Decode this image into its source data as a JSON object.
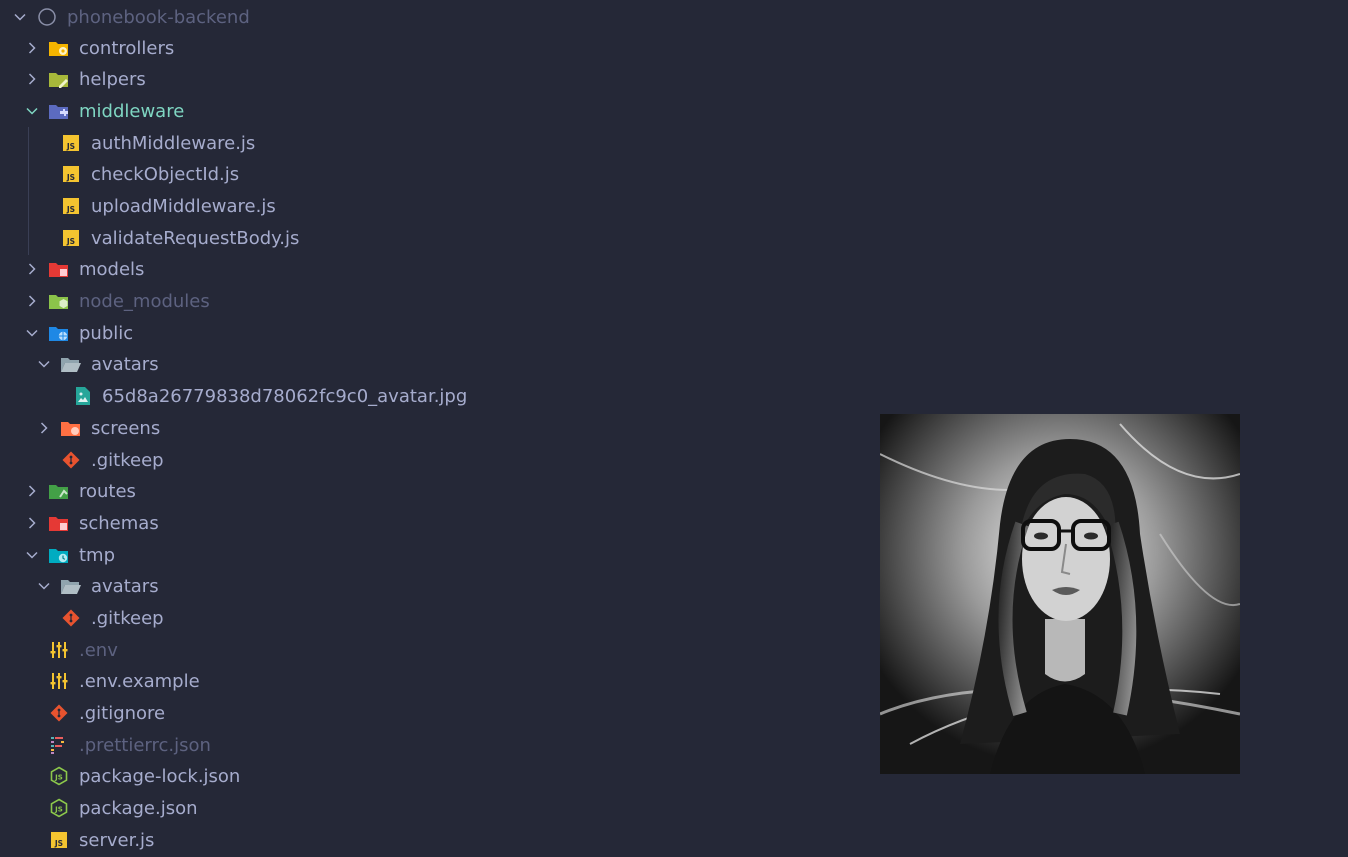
{
  "explorer": {
    "root": {
      "name": "phonebook-backend"
    },
    "items": [
      {
        "label": "controllers"
      },
      {
        "label": "helpers"
      },
      {
        "label": "middleware"
      },
      {
        "label": "authMiddleware.js"
      },
      {
        "label": "checkObjectId.js"
      },
      {
        "label": "uploadMiddleware.js"
      },
      {
        "label": "validateRequestBody.js"
      },
      {
        "label": "models"
      },
      {
        "label": "node_modules"
      },
      {
        "label": "public"
      },
      {
        "label": "avatars"
      },
      {
        "label": "65d8a26779838d78062fc9c0_avatar.jpg"
      },
      {
        "label": "screens"
      },
      {
        "label": ".gitkeep"
      },
      {
        "label": "routes"
      },
      {
        "label": "schemas"
      },
      {
        "label": "tmp"
      },
      {
        "label": "avatars"
      },
      {
        "label": ".gitkeep"
      },
      {
        "label": ".env"
      },
      {
        "label": ".env.example"
      },
      {
        "label": ".gitignore"
      },
      {
        "label": ".prettierrc.json"
      },
      {
        "label": "package-lock.json"
      },
      {
        "label": "package.json"
      },
      {
        "label": "server.js"
      }
    ]
  },
  "colors": {
    "background": "#252837",
    "text": "#a6accd",
    "selected": "#7fd6c2",
    "dimmed": "#5d6280",
    "js": "#f4c430",
    "git": "#e8532f"
  }
}
